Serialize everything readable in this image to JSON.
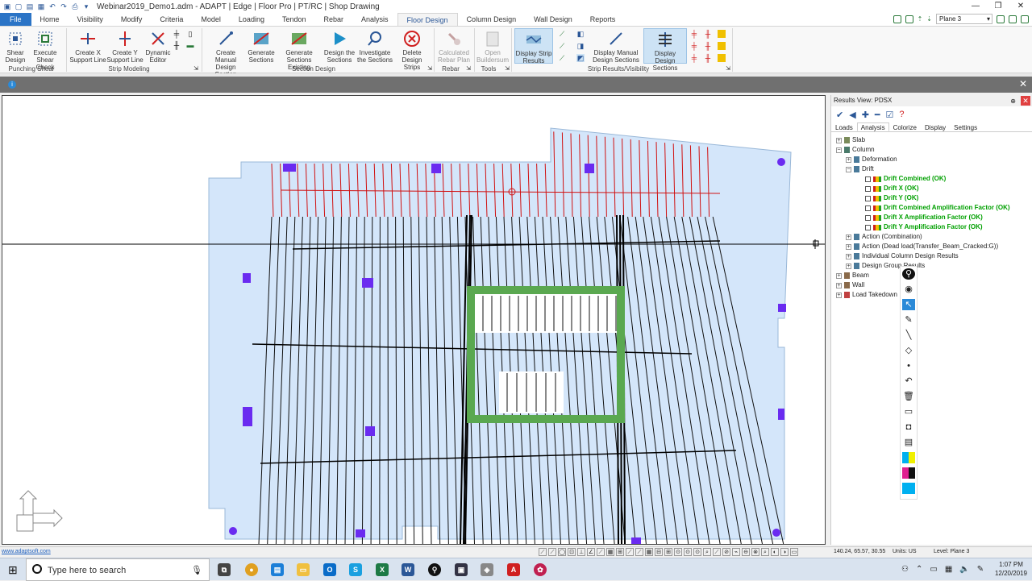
{
  "window": {
    "title": "Webinar2019_Demo1.adm - ADAPT | Edge | Floor Pro | PT/RC | Shop Drawing"
  },
  "menu": {
    "tabs": [
      "File",
      "Home",
      "Visibility",
      "Modify",
      "Criteria",
      "Model",
      "Loading",
      "Tendon",
      "Rebar",
      "Analysis",
      "Floor Design",
      "Column Design",
      "Wall Design",
      "Reports"
    ],
    "active": "Floor Design",
    "plane_label": "Plane 3"
  },
  "ribbon": {
    "buttons": [
      {
        "label": "Shear Design"
      },
      {
        "label": "Execute Shear Check"
      },
      {
        "label": "Create X Support Line"
      },
      {
        "label": "Create Y Support Line"
      },
      {
        "label": "Dynamic Editor"
      },
      {
        "label": "Create Manual Design Section"
      },
      {
        "label": "Generate Sections"
      },
      {
        "label": "Generate Sections Existing"
      },
      {
        "label": "Design the Sections"
      },
      {
        "label": "Investigate the Sections"
      },
      {
        "label": "Delete Design Strips"
      },
      {
        "label": "Calculated Rebar Plan"
      },
      {
        "label": "Open Buildersum"
      },
      {
        "label": "Display Strip Results"
      },
      {
        "label": "Display Manual Design Sections"
      },
      {
        "label": "Display Design Sections"
      }
    ],
    "groups": [
      "Punching Shear",
      "Strip Modeling",
      "Section Design",
      "Rebar",
      "Tools",
      "Strip Results/Visibility"
    ]
  },
  "results_view": {
    "title": "Results View: PDSX",
    "tabs": [
      "Loads",
      "Analysis",
      "Colorize",
      "Display",
      "Settings"
    ],
    "active_tab": "Analysis",
    "tree": [
      {
        "label": "Slab"
      },
      {
        "label": "Column"
      },
      {
        "label": "Deformation"
      },
      {
        "label": "Drift"
      },
      {
        "label": "Drift Combined (OK)"
      },
      {
        "label": "Drift X (OK)"
      },
      {
        "label": "Drift Y (OK)"
      },
      {
        "label": "Drift Combined Amplification Factor (OK)"
      },
      {
        "label": "Drift X Amplification Factor (OK)"
      },
      {
        "label": "Drift Y Amplification Factor (OK)"
      },
      {
        "label": "Action (Combination)"
      },
      {
        "label": "Action (Dead load(Transfer_Beam_Cracked:G))"
      },
      {
        "label": "Individual Column Design Results"
      },
      {
        "label": "Design Group Results"
      },
      {
        "label": "Beam"
      },
      {
        "label": "Wall"
      },
      {
        "label": "Load Takedown"
      }
    ]
  },
  "status": {
    "link": "www.adaptsoft.com",
    "coords": "140.24, 65.57, 30.55",
    "units": "Units: US",
    "level": "Level: Plane 3"
  },
  "taskbar": {
    "search_placeholder": "Type here to search",
    "time": "1:07 PM",
    "date": "12/20/2019"
  },
  "colors": {
    "accent": "#2b74c6",
    "slab": "#d4e6fa",
    "column": "#6a2bf0",
    "strip_red": "#d01010",
    "beam_green": "#5aa850"
  }
}
